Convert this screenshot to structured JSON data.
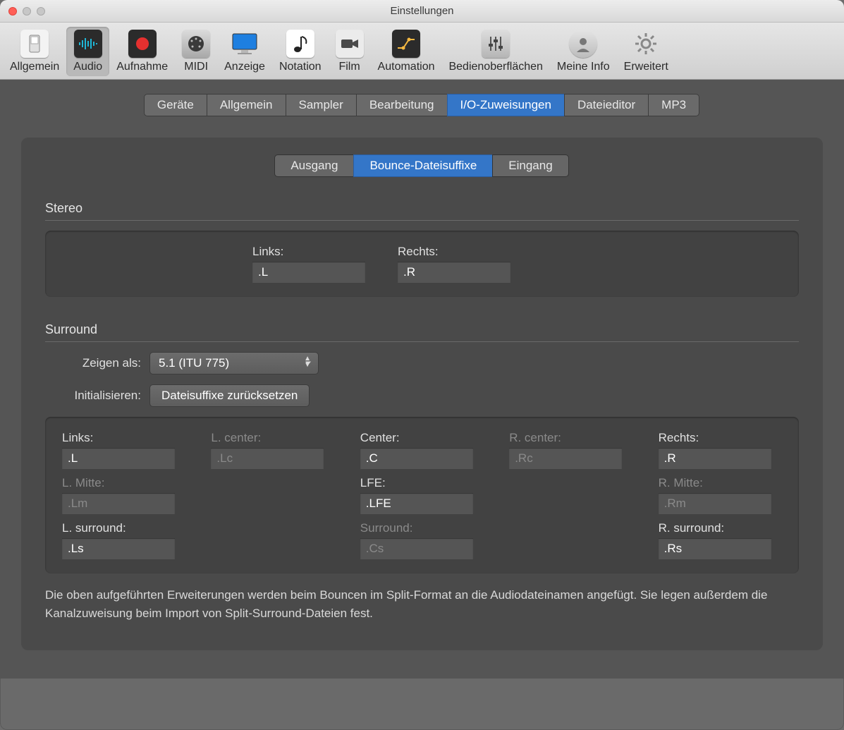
{
  "window": {
    "title": "Einstellungen"
  },
  "toolbar": {
    "items": [
      {
        "label": "Allgemein"
      },
      {
        "label": "Audio"
      },
      {
        "label": "Aufnahme"
      },
      {
        "label": "MIDI"
      },
      {
        "label": "Anzeige"
      },
      {
        "label": "Notation"
      },
      {
        "label": "Film"
      },
      {
        "label": "Automation"
      },
      {
        "label": "Bedienoberflächen"
      },
      {
        "label": "Meine Info"
      },
      {
        "label": "Erweitert"
      }
    ],
    "active_index": 1
  },
  "tabs": {
    "items": [
      "Geräte",
      "Allgemein",
      "Sampler",
      "Bearbeitung",
      "I/O-Zuweisungen",
      "Dateieditor",
      "MP3"
    ],
    "active_index": 4
  },
  "subtabs": {
    "items": [
      "Ausgang",
      "Bounce-Dateisuffixe",
      "Eingang"
    ],
    "active_index": 1
  },
  "stereo": {
    "heading": "Stereo",
    "left_label": "Links:",
    "left_value": ".L",
    "right_label": "Rechts:",
    "right_value": ".R"
  },
  "surround": {
    "heading": "Surround",
    "show_as_label": "Zeigen als:",
    "show_as_value": "5.1 (ITU 775)",
    "init_label": "Initialisieren:",
    "init_button": "Dateisuffixe zurücksetzen",
    "channels": [
      {
        "label": "Links:",
        "value": ".L",
        "dim": false
      },
      {
        "label": "L. center:",
        "value": ".Lc",
        "dim": true
      },
      {
        "label": "Center:",
        "value": ".C",
        "dim": false
      },
      {
        "label": "R. center:",
        "value": ".Rc",
        "dim": true
      },
      {
        "label": "Rechts:",
        "value": ".R",
        "dim": false
      },
      {
        "label": "L. Mitte:",
        "value": ".Lm",
        "dim": true
      },
      {
        "label": "",
        "value": "",
        "dim": true,
        "empty": true
      },
      {
        "label": "LFE:",
        "value": ".LFE",
        "dim": false
      },
      {
        "label": "",
        "value": "",
        "dim": true,
        "empty": true
      },
      {
        "label": "R. Mitte:",
        "value": ".Rm",
        "dim": true
      },
      {
        "label": "L. surround:",
        "value": ".Ls",
        "dim": false
      },
      {
        "label": "",
        "value": "",
        "dim": true,
        "empty": true
      },
      {
        "label": "Surround:",
        "value": ".Cs",
        "dim": true
      },
      {
        "label": "",
        "value": "",
        "dim": true,
        "empty": true
      },
      {
        "label": "R. surround:",
        "value": ".Rs",
        "dim": false
      }
    ]
  },
  "footer_text": "Die oben aufgeführten Erweiterungen werden beim Bouncen im Split-Format an die Audiodateinamen angefügt. Sie legen außerdem die Kanalzuweisung beim Import von Split-Surround-Dateien fest."
}
